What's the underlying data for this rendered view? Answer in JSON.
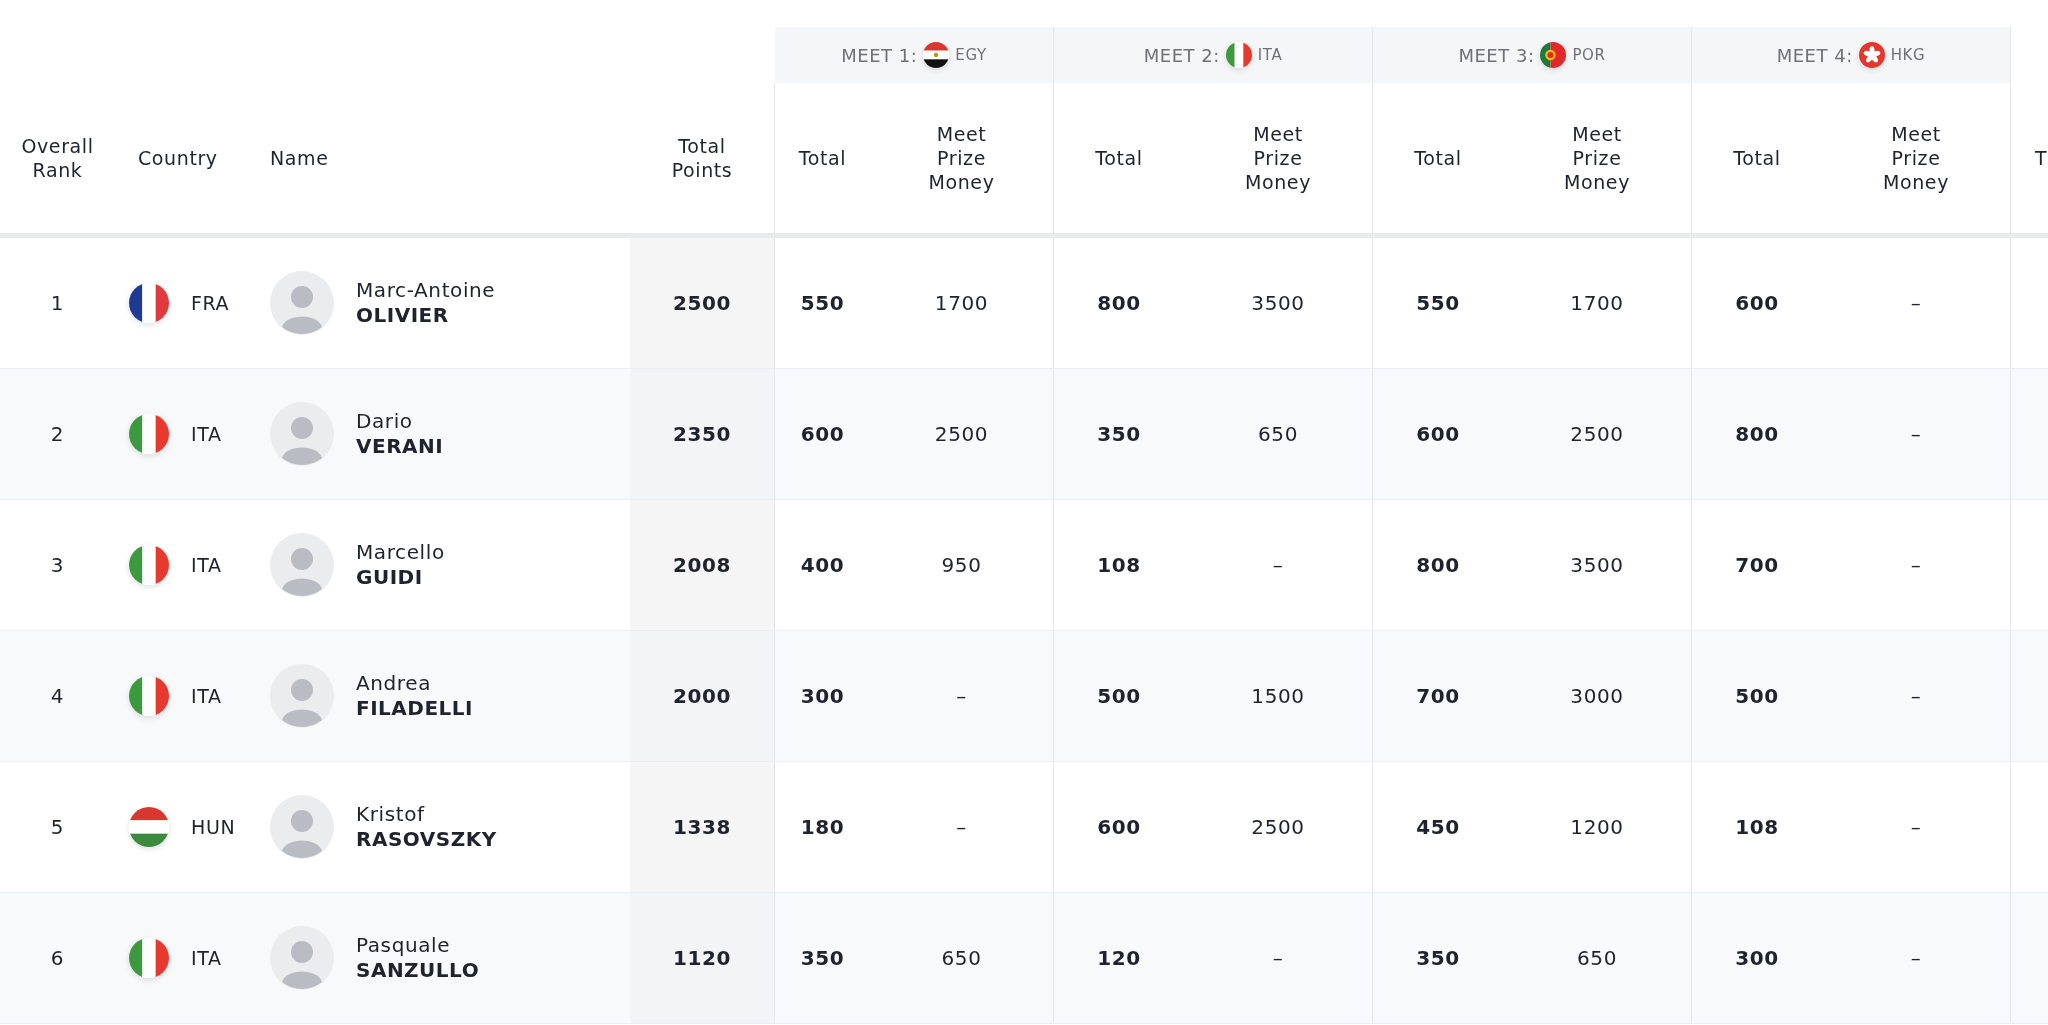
{
  "columns": [
    "Overall Rank",
    "Country",
    "Name",
    "Total Points"
  ],
  "meets": [
    {
      "label": "MEET 1:",
      "kind": "eg",
      "code": "EGY",
      "columns": [
        "Total",
        "Meet Prize Money"
      ]
    },
    {
      "label": "MEET 2:",
      "kind": "it",
      "code": "ITA",
      "columns": [
        "Total",
        "Meet Prize Money"
      ]
    },
    {
      "label": "MEET 3:",
      "kind": "pt",
      "code": "POR",
      "columns": [
        "Total",
        "Meet Prize Money"
      ]
    },
    {
      "label": "MEET 4:",
      "kind": "hk",
      "code": "HKG",
      "columns": [
        "Total",
        "Meet Prize Money"
      ]
    }
  ],
  "column_cut": "T",
  "rows": [
    {
      "rank": "1",
      "kind": "fr",
      "country": "FRA",
      "first_name": "Marc-Antoine",
      "last_name": "OLIVIER",
      "total_points": "2500",
      "meets": [
        {
          "total": "550",
          "prize": "1700"
        },
        {
          "total": "800",
          "prize": "3500"
        },
        {
          "total": "550",
          "prize": "1700"
        },
        {
          "total": "600",
          "prize": "–"
        }
      ]
    },
    {
      "rank": "2",
      "kind": "it",
      "country": "ITA",
      "first_name": "Dario",
      "last_name": "VERANI",
      "total_points": "2350",
      "meets": [
        {
          "total": "600",
          "prize": "2500"
        },
        {
          "total": "350",
          "prize": "650"
        },
        {
          "total": "600",
          "prize": "2500"
        },
        {
          "total": "800",
          "prize": "–"
        }
      ]
    },
    {
      "rank": "3",
      "kind": "it",
      "country": "ITA",
      "first_name": "Marcello",
      "last_name": "GUIDI",
      "total_points": "2008",
      "meets": [
        {
          "total": "400",
          "prize": "950"
        },
        {
          "total": "108",
          "prize": "–"
        },
        {
          "total": "800",
          "prize": "3500"
        },
        {
          "total": "700",
          "prize": "–"
        }
      ]
    },
    {
      "rank": "4",
      "kind": "it",
      "country": "ITA",
      "first_name": "Andrea",
      "last_name": "FILADELLI",
      "total_points": "2000",
      "meets": [
        {
          "total": "300",
          "prize": "–"
        },
        {
          "total": "500",
          "prize": "1500"
        },
        {
          "total": "700",
          "prize": "3000"
        },
        {
          "total": "500",
          "prize": "–"
        }
      ]
    },
    {
      "rank": "5",
      "kind": "hu",
      "country": "HUN",
      "first_name": "Kristof",
      "last_name": "RASOVSZKY",
      "total_points": "1338",
      "meets": [
        {
          "total": "180",
          "prize": "–"
        },
        {
          "total": "600",
          "prize": "2500"
        },
        {
          "total": "450",
          "prize": "1200"
        },
        {
          "total": "108",
          "prize": "–"
        }
      ]
    },
    {
      "rank": "6",
      "kind": "it",
      "country": "ITA",
      "first_name": "Pasquale",
      "last_name": "SANZULLO",
      "total_points": "1120",
      "meets": [
        {
          "total": "350",
          "prize": "650"
        },
        {
          "total": "120",
          "prize": "–"
        },
        {
          "total": "350",
          "prize": "650"
        },
        {
          "total": "300",
          "prize": "–"
        }
      ]
    }
  ]
}
